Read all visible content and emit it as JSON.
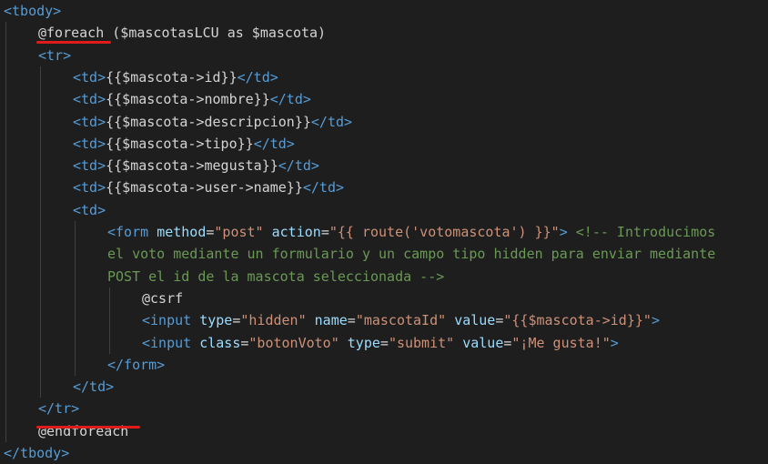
{
  "colors": {
    "background": "#1e1e1e",
    "tag": "#569cd6",
    "attribute": "#9cdcfe",
    "string": "#ce9178",
    "comment": "#6a9955",
    "text": "#d4d4d4",
    "annotation_underline": "#e01b1b"
  },
  "code_lines": [
    {
      "indent": 0,
      "tokens": [
        {
          "t": "tag",
          "v": "<tbody>"
        }
      ]
    },
    {
      "indent": 1,
      "tokens": [
        {
          "t": "dir",
          "v": "@foreach"
        },
        {
          "t": "plain",
          "v": " ($mascotasLCU as $mascota)"
        }
      ]
    },
    {
      "indent": 1,
      "tokens": [
        {
          "t": "tag",
          "v": "<tr>"
        }
      ]
    },
    {
      "indent": 2,
      "tokens": [
        {
          "t": "tag",
          "v": "<td>"
        },
        {
          "t": "plain",
          "v": "{{$mascota->id}}"
        },
        {
          "t": "tag",
          "v": "</td>"
        }
      ]
    },
    {
      "indent": 2,
      "tokens": [
        {
          "t": "tag",
          "v": "<td>"
        },
        {
          "t": "plain",
          "v": "{{$mascota->nombre}}"
        },
        {
          "t": "tag",
          "v": "</td>"
        }
      ]
    },
    {
      "indent": 2,
      "tokens": [
        {
          "t": "tag",
          "v": "<td>"
        },
        {
          "t": "plain",
          "v": "{{$mascota->descripcion}}"
        },
        {
          "t": "tag",
          "v": "</td>"
        }
      ]
    },
    {
      "indent": 2,
      "tokens": [
        {
          "t": "tag",
          "v": "<td>"
        },
        {
          "t": "plain",
          "v": "{{$mascota->tipo}}"
        },
        {
          "t": "tag",
          "v": "</td>"
        }
      ]
    },
    {
      "indent": 2,
      "tokens": [
        {
          "t": "tag",
          "v": "<td>"
        },
        {
          "t": "plain",
          "v": "{{$mascota->megusta}}"
        },
        {
          "t": "tag",
          "v": "</td>"
        }
      ]
    },
    {
      "indent": 2,
      "tokens": [
        {
          "t": "tag",
          "v": "<td>"
        },
        {
          "t": "plain",
          "v": "{{$mascota->user->name}}"
        },
        {
          "t": "tag",
          "v": "</td>"
        }
      ]
    },
    {
      "indent": 2,
      "tokens": [
        {
          "t": "tag",
          "v": "<td>"
        }
      ]
    },
    {
      "indent": 3,
      "tokens": [
        {
          "t": "tag",
          "v": "<form"
        },
        {
          "t": "plain",
          "v": " "
        },
        {
          "t": "attr",
          "v": "method"
        },
        {
          "t": "plain",
          "v": "="
        },
        {
          "t": "str",
          "v": "\"post\""
        },
        {
          "t": "plain",
          "v": " "
        },
        {
          "t": "attr",
          "v": "action"
        },
        {
          "t": "plain",
          "v": "="
        },
        {
          "t": "str",
          "v": "\"{{ route('votomascota') }}\""
        },
        {
          "t": "tag",
          "v": ">"
        },
        {
          "t": "plain",
          "v": " "
        },
        {
          "t": "com",
          "v": "<!-- Introducimos"
        }
      ]
    },
    {
      "indent": 3,
      "tokens": [
        {
          "t": "com",
          "v": "el voto mediante un formulario y un campo tipo hidden para enviar mediante"
        }
      ]
    },
    {
      "indent": 3,
      "tokens": [
        {
          "t": "com",
          "v": "POST el id de la mascota seleccionada -->"
        }
      ]
    },
    {
      "indent": 4,
      "tokens": [
        {
          "t": "dir",
          "v": "@csrf"
        }
      ]
    },
    {
      "indent": 4,
      "tokens": [
        {
          "t": "tag",
          "v": "<input"
        },
        {
          "t": "plain",
          "v": " "
        },
        {
          "t": "attr",
          "v": "type"
        },
        {
          "t": "plain",
          "v": "="
        },
        {
          "t": "str",
          "v": "\"hidden\""
        },
        {
          "t": "plain",
          "v": " "
        },
        {
          "t": "attr",
          "v": "name"
        },
        {
          "t": "plain",
          "v": "="
        },
        {
          "t": "str",
          "v": "\"mascotaId\""
        },
        {
          "t": "plain",
          "v": " "
        },
        {
          "t": "attr",
          "v": "value"
        },
        {
          "t": "plain",
          "v": "="
        },
        {
          "t": "str",
          "v": "\"{{$mascota->id}}\""
        },
        {
          "t": "tag",
          "v": ">"
        }
      ]
    },
    {
      "indent": 4,
      "tokens": [
        {
          "t": "tag",
          "v": "<input"
        },
        {
          "t": "plain",
          "v": " "
        },
        {
          "t": "attr",
          "v": "class"
        },
        {
          "t": "plain",
          "v": "="
        },
        {
          "t": "str",
          "v": "\"botonVoto\""
        },
        {
          "t": "plain",
          "v": " "
        },
        {
          "t": "attr",
          "v": "type"
        },
        {
          "t": "plain",
          "v": "="
        },
        {
          "t": "str",
          "v": "\"submit\""
        },
        {
          "t": "plain",
          "v": " "
        },
        {
          "t": "attr",
          "v": "value"
        },
        {
          "t": "plain",
          "v": "="
        },
        {
          "t": "str",
          "v": "\"¡Me gusta!\""
        },
        {
          "t": "tag",
          "v": ">"
        }
      ]
    },
    {
      "indent": 3,
      "tokens": [
        {
          "t": "tag",
          "v": "</form>"
        }
      ]
    },
    {
      "indent": 2,
      "tokens": [
        {
          "t": "tag",
          "v": "</td>"
        }
      ]
    },
    {
      "indent": 1,
      "tokens": [
        {
          "t": "tag",
          "v": "</tr>"
        }
      ]
    },
    {
      "indent": 1,
      "tokens": [
        {
          "t": "dir",
          "v": "@endforeach"
        }
      ]
    },
    {
      "indent": 0,
      "tokens": [
        {
          "t": "tag",
          "v": "</tbody>"
        }
      ]
    }
  ]
}
